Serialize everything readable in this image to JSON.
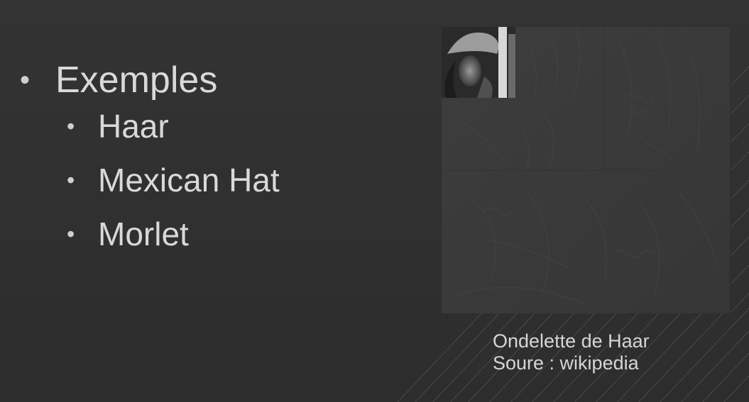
{
  "slide": {
    "bullets": {
      "main": "Exemples",
      "items": [
        "Haar",
        "Mexican Hat",
        "Morlet"
      ]
    },
    "image": {
      "icon": "haar-wavelet-decomposition-image"
    },
    "caption": {
      "line1": "Ondelette de Haar",
      "line2": "Soure : wikipedia"
    }
  }
}
